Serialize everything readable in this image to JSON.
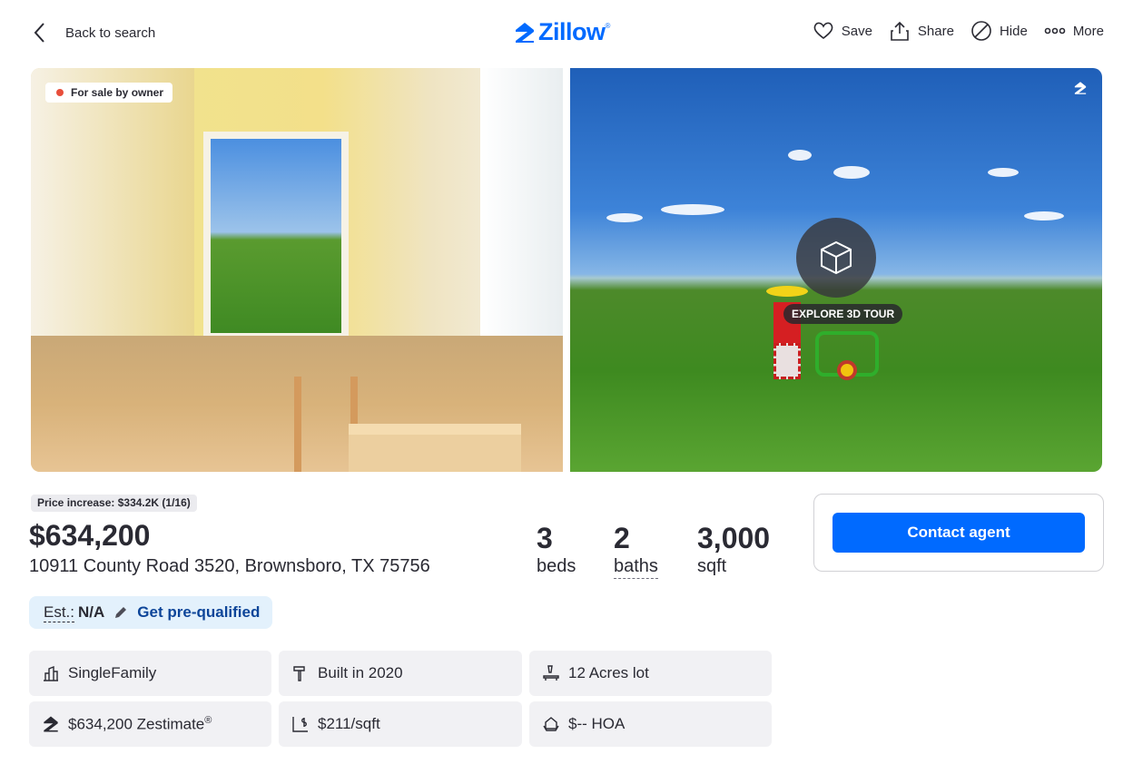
{
  "header": {
    "back_label": "Back to search",
    "logo_text": "Zillow",
    "logo_mark": "®",
    "actions": [
      {
        "label": "Save",
        "icon": "heart-icon"
      },
      {
        "label": "Share",
        "icon": "share-icon"
      },
      {
        "label": "Hide",
        "icon": "hide-icon"
      },
      {
        "label": "More",
        "icon": "more-icon"
      }
    ]
  },
  "gallery": {
    "badge": "For sale by owner",
    "tour_label": "EXPLORE 3D TOUR"
  },
  "listing": {
    "price_change": "Price increase: $334.2K (1/16)",
    "price": "$634,200",
    "address": "10911 County Road 3520, Brownsboro, TX 75756",
    "beds": {
      "value": "3",
      "unit": "beds"
    },
    "baths": {
      "value": "2",
      "unit": "baths"
    },
    "sqft": {
      "value": "3,000",
      "unit": "sqft"
    },
    "estimate": {
      "label": "Est.:",
      "value": "N/A",
      "link": "Get pre-qualified"
    }
  },
  "facts": [
    {
      "icon": "building-icon",
      "text": "SingleFamily"
    },
    {
      "icon": "hammer-icon",
      "text": "Built in 2020"
    },
    {
      "icon": "lot-icon",
      "text": "12 Acres lot"
    },
    {
      "icon": "zestimate-icon",
      "text": "$634,200 Zestimate",
      "mark": "®"
    },
    {
      "icon": "price-per-sqft-icon",
      "text": "$211/sqft"
    },
    {
      "icon": "hoa-icon",
      "text": "$-- HOA"
    }
  ],
  "contact": {
    "button_label": "Contact agent"
  },
  "colors": {
    "brand": "#006aff",
    "link": "#0d4599",
    "badge_dot": "#e84e3b",
    "est_bg": "#e3f1fc"
  }
}
